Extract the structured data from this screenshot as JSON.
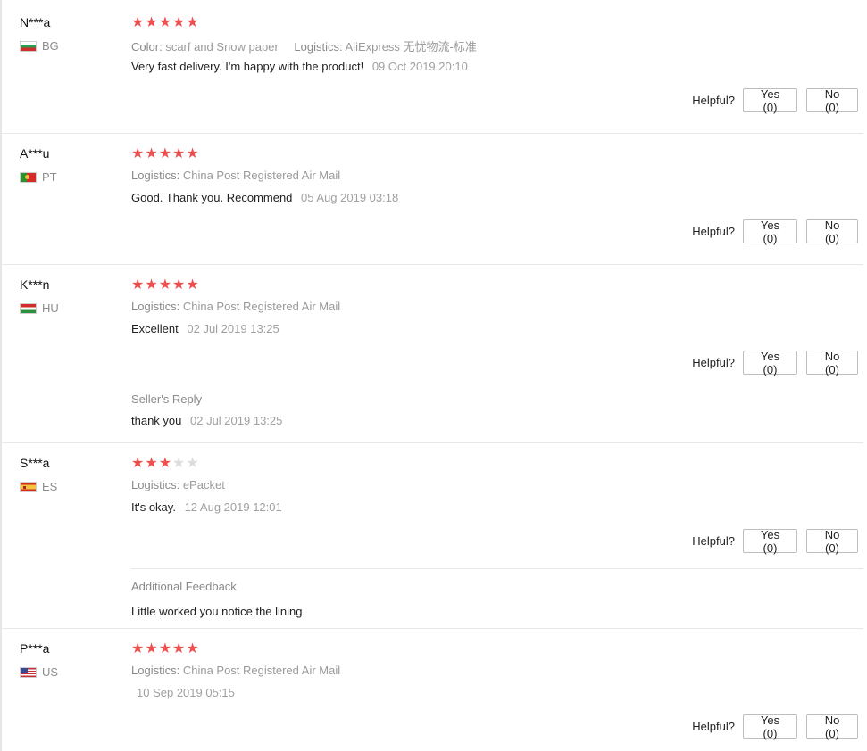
{
  "helpful_label": "Helpful?",
  "reviews": [
    {
      "user": "N***a",
      "country": "BG",
      "rating": 5,
      "color_key": "Color:",
      "color_val": "scarf and Snow paper",
      "logistics_key": "Logistics:",
      "logistics_val": "AliExpress 无忧物流-标准",
      "text": "Very fast delivery. I'm happy with the product!",
      "date": "09 Oct 2019 20:10",
      "yes": "Yes (0)",
      "no": "No (0)"
    },
    {
      "user": "A***u",
      "country": "PT",
      "rating": 5,
      "logistics_key": "Logistics:",
      "logistics_val": "China Post Registered Air Mail",
      "text": "Good. Thank you. Recommend",
      "date": "05 Aug 2019 03:18",
      "yes": "Yes (0)",
      "no": "No (0)"
    },
    {
      "user": "K***n",
      "country": "HU",
      "rating": 5,
      "logistics_key": "Logistics:",
      "logistics_val": "China Post Registered Air Mail",
      "text": "Excellent",
      "date": "02 Jul 2019 13:25",
      "yes": "Yes (0)",
      "no": "No (0)",
      "reply_title": "Seller's Reply",
      "reply_text": "thank you",
      "reply_date": "02 Jul 2019 13:25"
    },
    {
      "user": "S***a",
      "country": "ES",
      "rating": 3,
      "logistics_key": "Logistics:",
      "logistics_val": "ePacket",
      "text": "It's okay.",
      "date": "12 Aug 2019 12:01",
      "yes": "Yes (0)",
      "no": "No (0)",
      "additional_title": "Additional Feedback",
      "additional_text": "Little worked you notice the lining"
    },
    {
      "user": "P***a",
      "country": "US",
      "rating": 5,
      "logistics_key": "Logistics:",
      "logistics_val": "China Post Registered Air Mail",
      "text": "",
      "date": "10 Sep 2019 05:15",
      "yes": "Yes (0)",
      "no": "No (0)"
    }
  ]
}
